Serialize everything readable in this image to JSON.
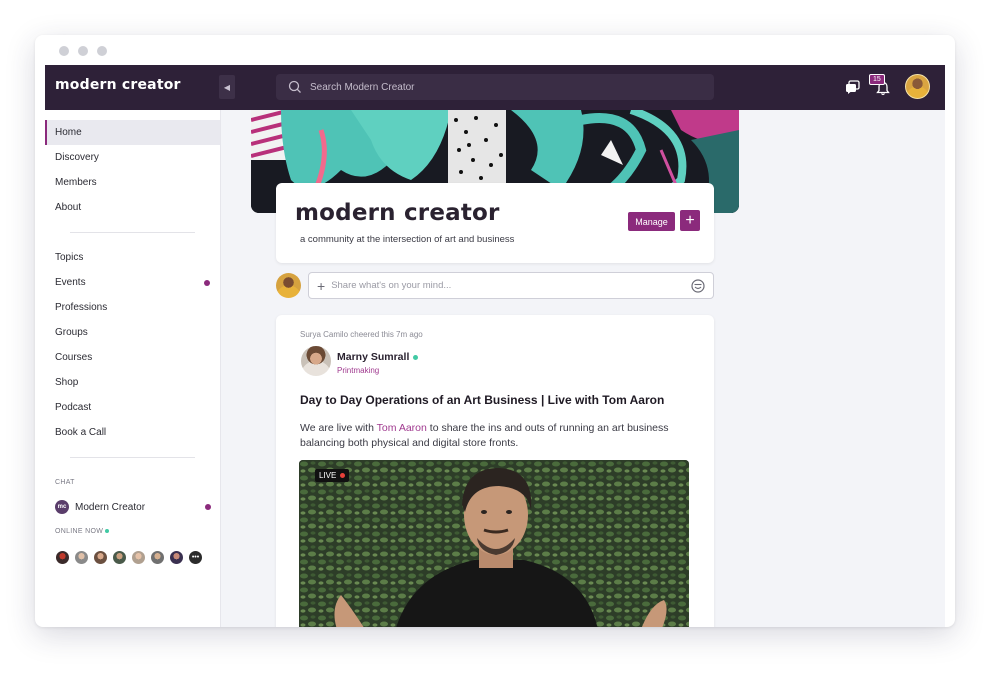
{
  "app": {
    "brand": "modern creator",
    "search_placeholder": "Search Modern Creator",
    "notification_count": "15"
  },
  "sidebar": {
    "items": [
      {
        "label": "Home",
        "active": true
      },
      {
        "label": "Discovery"
      },
      {
        "label": "Members"
      },
      {
        "label": "About"
      },
      {
        "label": "Topics"
      },
      {
        "label": "Events",
        "dot": true
      },
      {
        "label": "Professions"
      },
      {
        "label": "Groups"
      },
      {
        "label": "Courses"
      },
      {
        "label": "Shop"
      },
      {
        "label": "Podcast"
      },
      {
        "label": "Book a Call"
      }
    ],
    "chat_label": "CHAT",
    "chat_room": "Modern Creator",
    "chat_room_icon": "mc",
    "online_label": "ONLINE NOW"
  },
  "community": {
    "title": "modern creator",
    "subtitle": "a community at the intersection of art and business",
    "manage_label": "Manage",
    "add_label": "+"
  },
  "composer": {
    "placeholder": "Share what's on your mind..."
  },
  "post": {
    "cheer_text": "Surya Camilo cheered this 7m ago",
    "author": "Marny Sumrall",
    "author_tag": "Printmaking",
    "title": "Day to Day Operations of an Art Business | Live with Tom Aaron",
    "body_before": "We are live with ",
    "body_link": "Tom Aaron",
    "body_after": " to share the ins and outs of running an art business balancing both physical and digital store fronts.",
    "live_label": "LIVE"
  },
  "colors": {
    "topbar": "#2e2138",
    "accent": "#8b2a7c",
    "online": "#41c9a4"
  }
}
